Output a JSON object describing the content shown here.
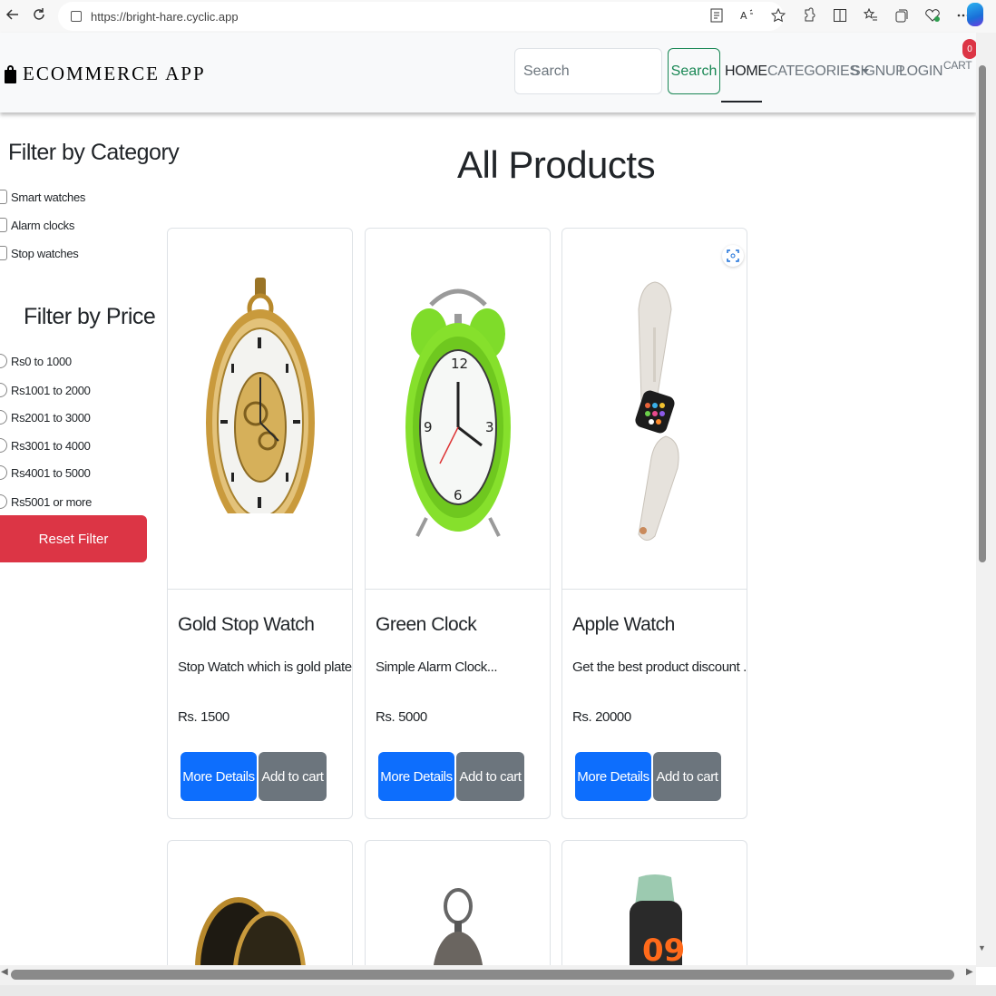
{
  "browser": {
    "url": "https://bright-hare.cyclic.app",
    "icons": [
      "reader-icon",
      "read-aloud-icon",
      "favorite-icon",
      "extensions-icon",
      "split-screen-icon",
      "favorites-icon",
      "collections-icon",
      "health-icon",
      "more-icon"
    ]
  },
  "navbar": {
    "brand": "ECOMMERCE APP",
    "search_placeholder": "Search",
    "search_button": "Search",
    "links": {
      "home": "HOME",
      "categories": "CATEGORIES",
      "signup": "SIGNUP",
      "login": "LOGIN",
      "cart": "CART"
    },
    "cart_count": "0"
  },
  "filters": {
    "category_title": "Filter by Category",
    "categories": [
      "Smart watches",
      "Alarm clocks",
      "Stop watches"
    ],
    "price_title": "Filter by Price",
    "prices": [
      "Rs0 to 1000",
      "Rs1001 to 2000",
      "Rs2001 to 3000",
      "Rs3001 to 4000",
      "Rs4001 to 5000",
      "Rs5001 or more"
    ],
    "reset_button": "Reset Filter"
  },
  "main": {
    "title": "All Products",
    "products": [
      {
        "name": "Gold Stop Watch",
        "description": "Stop Watch which is gold plate...",
        "price": "Rs. 1500",
        "more_label": "More Details",
        "cart_label": "Add to cart"
      },
      {
        "name": "Green Clock",
        "description": "Simple Alarm Clock...",
        "price": "Rs. 5000",
        "more_label": "More Details",
        "cart_label": "Add to cart"
      },
      {
        "name": "Apple Watch",
        "description": "Get the best product discount ...",
        "price": "Rs. 20000",
        "more_label": "More Details",
        "cart_label": "Add to cart"
      }
    ],
    "partial_products_visible": 3
  },
  "colors": {
    "primary": "#0d6efd",
    "secondary": "#6c757d",
    "danger": "#dc3545",
    "success": "#198754",
    "navbar_bg": "#f8f9fa"
  }
}
